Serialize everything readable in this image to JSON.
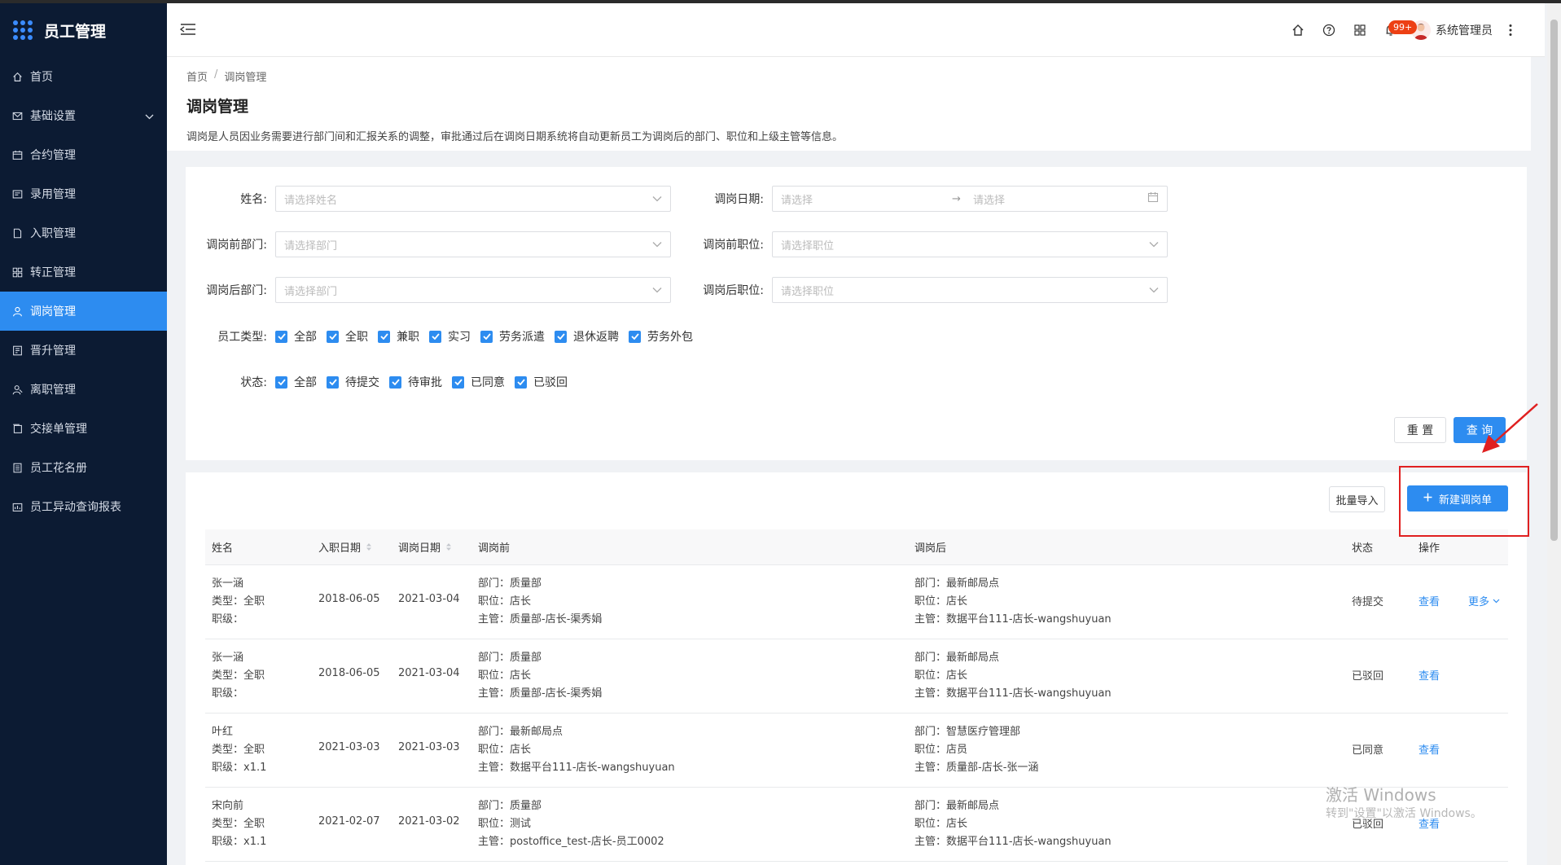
{
  "app": {
    "title": "员工管理"
  },
  "sidebar": {
    "items": [
      {
        "label": "首页",
        "icon": "home-icon"
      },
      {
        "label": "基础设置",
        "icon": "mail-icon",
        "expandable": true
      },
      {
        "label": "合约管理",
        "icon": "calendar-icon"
      },
      {
        "label": "录用管理",
        "icon": "id-card-icon"
      },
      {
        "label": "入职管理",
        "icon": "document-icon"
      },
      {
        "label": "转正管理",
        "icon": "grid-icon"
      },
      {
        "label": "调岗管理",
        "icon": "user-icon",
        "active": true
      },
      {
        "label": "晋升管理",
        "icon": "report-icon"
      },
      {
        "label": "离职管理",
        "icon": "user-leave-icon"
      },
      {
        "label": "交接单管理",
        "icon": "handover-icon"
      },
      {
        "label": "员工花名册",
        "icon": "roster-icon"
      },
      {
        "label": "员工异动查询报表",
        "icon": "chart-report-icon"
      }
    ]
  },
  "header": {
    "notification_count": "99+",
    "username": "系统管理员"
  },
  "breadcrumb": {
    "home": "首页",
    "sep": "/",
    "current": "调岗管理"
  },
  "page": {
    "title": "调岗管理",
    "description": "调岗是人员因业务需要进行部门间和汇报关系的调整，审批通过后在调岗日期系统将自动更新员工为调岗后的部门、职位和上级主管等信息。"
  },
  "filters": {
    "name_label": "姓名:",
    "name_placeholder": "请选择姓名",
    "date_label": "调岗日期:",
    "date_start_placeholder": "请选择",
    "date_arrow": "→",
    "date_end_placeholder": "请选择",
    "before_dept_label": "调岗前部门:",
    "before_dept_placeholder": "请选择部门",
    "before_pos_label": "调岗前职位:",
    "before_pos_placeholder": "请选择职位",
    "after_dept_label": "调岗后部门:",
    "after_dept_placeholder": "请选择部门",
    "after_pos_label": "调岗后职位:",
    "after_pos_placeholder": "请选择职位",
    "emp_type_label": "员工类型:",
    "emp_types": [
      "全部",
      "全职",
      "兼职",
      "实习",
      "劳务派遣",
      "退休返聘",
      "劳务外包"
    ],
    "status_label": "状态:",
    "statuses": [
      "全部",
      "待提交",
      "待审批",
      "已同意",
      "已驳回"
    ],
    "reset_label": "重 置",
    "query_label": "查 询"
  },
  "actions": {
    "import_label": "批量导入",
    "new_label": "新建调岗单"
  },
  "table": {
    "columns": [
      "姓名",
      "入职日期",
      "调岗日期",
      "调岗前",
      "调岗后",
      "状态",
      "操作"
    ],
    "rows": [
      {
        "name": "张一涵",
        "type": "类型：全职",
        "level": "职级：",
        "join_date": "2018-06-05",
        "transfer_date": "2021-03-04",
        "before_dept": "部门：质量部",
        "before_pos": "职位：店长",
        "before_mgr": "主管：质量部-店长-渠秀娟",
        "after_dept": "部门：最新邮局点",
        "after_pos": "职位：店长",
        "after_mgr": "主管：数据平台111-店长-wangshuyuan",
        "status": "待提交",
        "view": "查看",
        "more": "更多"
      },
      {
        "name": "张一涵",
        "type": "类型：全职",
        "level": "职级：",
        "join_date": "2018-06-05",
        "transfer_date": "2021-03-04",
        "before_dept": "部门：质量部",
        "before_pos": "职位：店长",
        "before_mgr": "主管：质量部-店长-渠秀娟",
        "after_dept": "部门：最新邮局点",
        "after_pos": "职位：店长",
        "after_mgr": "主管：数据平台111-店长-wangshuyuan",
        "status": "已驳回",
        "view": "查看",
        "more": ""
      },
      {
        "name": "叶红",
        "type": "类型：全职",
        "level": "职级：x1.1",
        "join_date": "2021-03-03",
        "transfer_date": "2021-03-03",
        "before_dept": "部门：最新邮局点",
        "before_pos": "职位：店长",
        "before_mgr": "主管：数据平台111-店长-wangshuyuan",
        "after_dept": "部门：智慧医疗管理部",
        "after_pos": "职位：店员",
        "after_mgr": "主管：质量部-店长-张一涵",
        "status": "已同意",
        "view": "查看",
        "more": ""
      },
      {
        "name": "宋向前",
        "type": "类型：全职",
        "level": "职级：x1.1",
        "join_date": "2021-02-07",
        "transfer_date": "2021-03-02",
        "before_dept": "部门：质量部",
        "before_pos": "职位：测试",
        "before_mgr": "主管：postoffice_test-店长-员工0002",
        "after_dept": "部门：最新邮局点",
        "after_pos": "职位：店长",
        "after_mgr": "主管：数据平台111-店长-wangshuyuan",
        "status": "已驳回",
        "view": "查看",
        "more": ""
      }
    ]
  },
  "watermark": {
    "line1": "激活 Windows",
    "line2": "转到\"设置\"以激活 Windows。"
  },
  "colors": {
    "sidebar_bg": "#0c1b33",
    "primary": "#2d8cf0",
    "annotation": "#e02020"
  }
}
